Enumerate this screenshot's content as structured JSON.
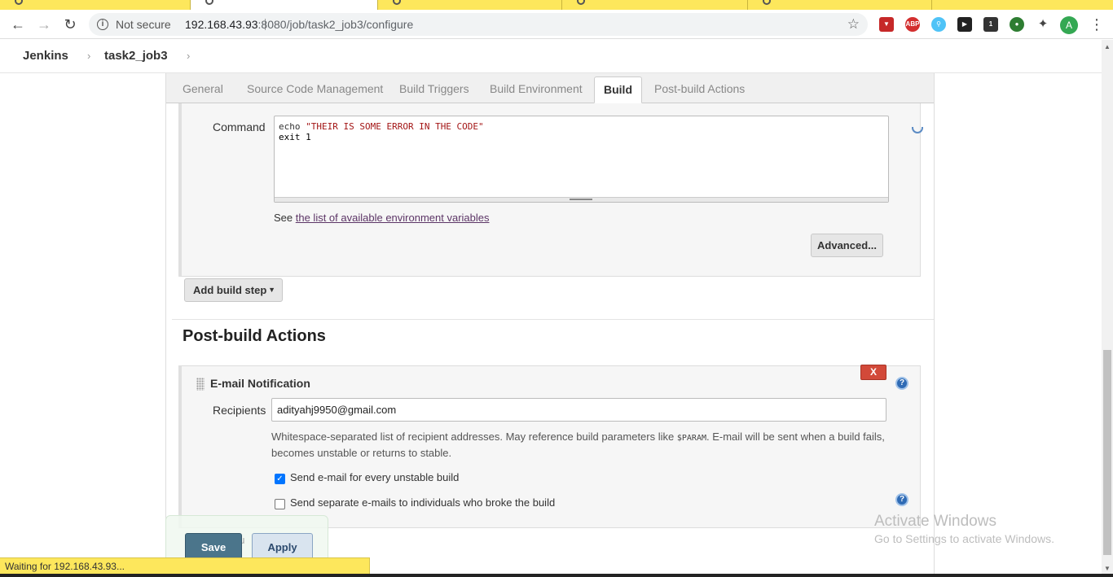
{
  "browser": {
    "security_label": "Not secure",
    "url_host": "192.168.43.93",
    "url_rest": ":8080/job/task2_job3/configure",
    "avatar_letter": "A",
    "status_text": "Waiting for 192.168.43.93...",
    "extensions": [
      "download-ext",
      "adblock-ext",
      "search-ext",
      "clapper-ext",
      "box-ext",
      "globe-ext",
      "puzzle-ext"
    ]
  },
  "breadcrumb": {
    "home": "Jenkins",
    "job": "task2_job3"
  },
  "config_tabs": [
    "General",
    "Source Code Management",
    "Build Triggers",
    "Build Environment",
    "Build",
    "Post-build Actions"
  ],
  "active_tab": "Build",
  "build": {
    "command_label": "Command",
    "command_line1_kw": "echo ",
    "command_line1_str": "\"THEIR IS SOME ERROR IN THE CODE\"",
    "command_line2": "exit 1",
    "env_prefix": "See ",
    "env_link": "the list of available environment variables",
    "advanced_button": "Advanced...",
    "add_build_step": "Add build step"
  },
  "post_build": {
    "title": "Post-build Actions",
    "email_title": "E-mail Notification",
    "delete_label": "X",
    "recipients_label": "Recipients",
    "recipients_value": "adityahj9950@gmail.com",
    "desc_part1": "Whitespace-separated list of recipient addresses. May reference build parameters like ",
    "desc_code": "$PARAM",
    "desc_part2": ". E-mail will be sent when a build fails, becomes unstable or returns to stable.",
    "cb_unstable_label": "Send e-mail for every unstable build",
    "cb_unstable_checked": true,
    "cb_separate_label": "Send separate e-mails to individuals who broke the build",
    "cb_separate_checked": false
  },
  "footer": {
    "save": "Save",
    "apply": "Apply",
    "ghost_text": "bu"
  },
  "watermark": {
    "line1": "Activate Windows",
    "line2": "Go to Settings to activate Windows."
  },
  "colors": {
    "tabstrip": "#fde75c",
    "save_button": "#4b758b",
    "delete_button": "#d24939",
    "help_icon": "#2f6bb5"
  }
}
